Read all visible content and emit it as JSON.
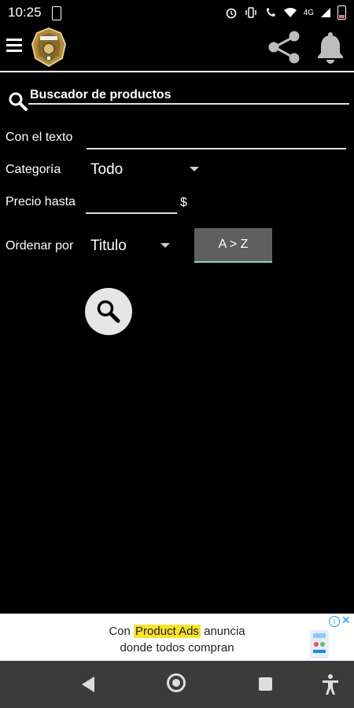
{
  "status_bar": {
    "time": "10:25",
    "network_label": "4G",
    "icons": [
      "sim-card-icon",
      "alarm-icon",
      "vibrate-icon",
      "wifi-calling-icon",
      "wifi-icon",
      "signal-icon",
      "battery-icon"
    ]
  },
  "app_bar": {
    "icons": [
      "menu-icon",
      "badge-logo",
      "share-icon",
      "bell-icon"
    ]
  },
  "search": {
    "title": "Buscador de productos",
    "text_label": "Con el texto",
    "text_value": "",
    "category_label": "Categoría",
    "category_value": "Todo",
    "price_label": "Precio hasta",
    "price_value": "",
    "currency": "$",
    "order_label": "Ordenar por",
    "order_value": "Titulo",
    "order_direction_label": "A > Z"
  },
  "ad": {
    "line1_before": "Con",
    "line1_highlight": "Product Ads",
    "line1_after": "anuncia",
    "line2": "donde todos compran",
    "info_symbol": "i",
    "close_symbol": "✕"
  },
  "colors": {
    "background": "#000000",
    "accent_underline": "#7fd7c4",
    "ad_highlight": "#f7e32c",
    "nav_bar": "#3b3b3b"
  }
}
